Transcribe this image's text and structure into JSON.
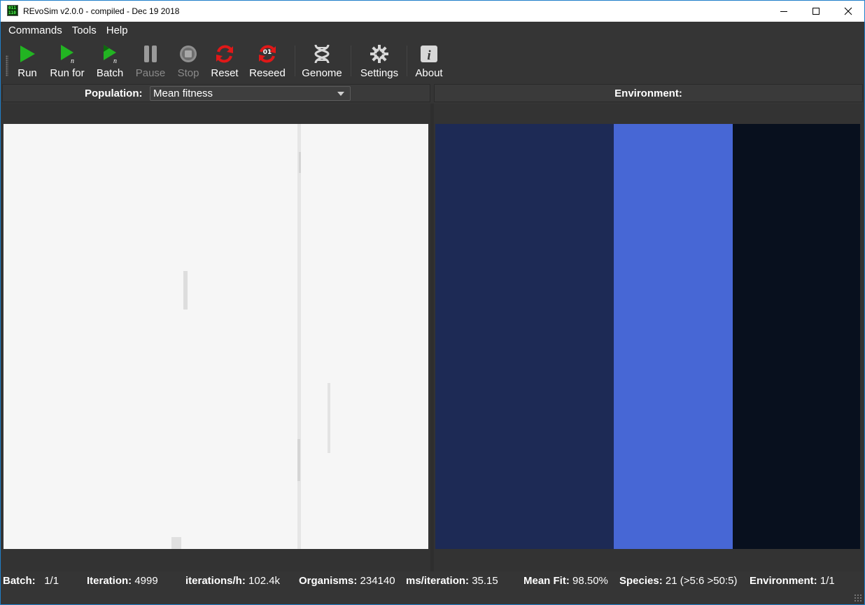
{
  "window": {
    "title": "REvoSim v2.0.0 - compiled - Dec 19 2018",
    "app_icon_text": [
      "011",
      "110"
    ],
    "controls": {
      "minimize_icon": "minimize-icon",
      "maximize_icon": "maximize-icon",
      "close_icon": "close-icon"
    }
  },
  "menu": {
    "items": [
      "Commands",
      "Tools",
      "Help"
    ]
  },
  "toolbar": {
    "run": {
      "label": "Run",
      "icon": "play-icon",
      "enabled": true
    },
    "run_for": {
      "label": "Run for",
      "icon": "play-n-icon",
      "enabled": true
    },
    "batch": {
      "label": "Batch",
      "icon": "batch-play-icon",
      "enabled": true
    },
    "pause": {
      "label": "Pause",
      "icon": "pause-icon",
      "enabled": false
    },
    "stop": {
      "label": "Stop",
      "icon": "stop-icon",
      "enabled": false
    },
    "reset": {
      "label": "Reset",
      "icon": "reset-icon",
      "enabled": true
    },
    "reseed": {
      "label": "Reseed",
      "icon": "reseed-icon",
      "badge": "01",
      "enabled": true
    },
    "genome": {
      "label": "Genome",
      "icon": "dna-icon",
      "enabled": true
    },
    "settings": {
      "label": "Settings",
      "icon": "gear-icon",
      "enabled": true
    },
    "about": {
      "label": "About",
      "icon": "info-icon",
      "enabled": true
    }
  },
  "population_panel": {
    "label": "Population:",
    "mode_selected": "Mean fitness"
  },
  "environment_panel": {
    "label": "Environment:"
  },
  "status": {
    "batch_label": "Batch:",
    "batch_value": "1/1",
    "iteration_label": "Iteration:",
    "iteration_value": "4999",
    "rate_label": "iterations/h:",
    "rate_value": "102.4k",
    "organisms_label": "Organisms:",
    "organisms_value": "234140",
    "ms_label": "ms/iteration:",
    "ms_value": "35.15",
    "fit_label": "Mean Fit:",
    "fit_value": "98.50%",
    "species_label": "Species:",
    "species_value": "21 (>5:6 >50:5)",
    "env_label": "Environment:",
    "env_value": "1/1"
  },
  "colors": {
    "window_bg": "#353535",
    "accent_green": "#22b422",
    "accent_red": "#e01818",
    "env_band_1": "#1d2a55",
    "env_band_2": "#4767d5",
    "env_band_3": "#08101e",
    "population_bg": "#f6f6f6"
  }
}
